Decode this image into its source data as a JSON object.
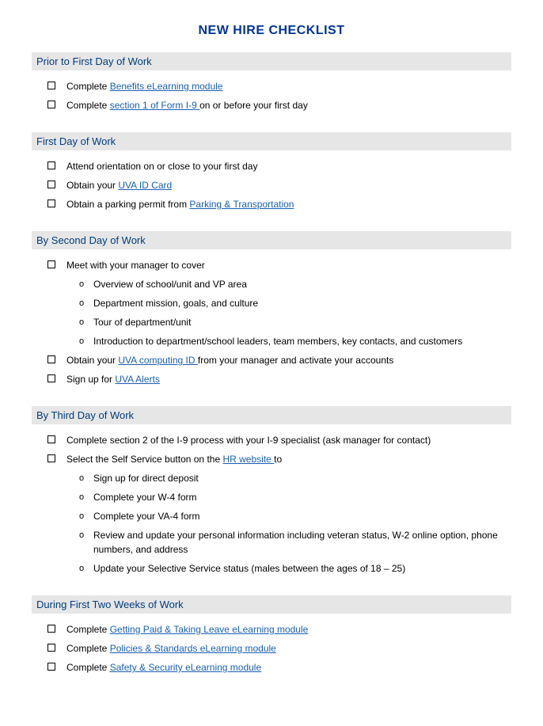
{
  "title": "NEW HIRE CHECKLIST",
  "sections": [
    {
      "header": "Prior to First Day of Work",
      "items": [
        {
          "parts": [
            {
              "text": "Complete "
            },
            {
              "text": "Benefits eLearning module",
              "link": true
            }
          ]
        },
        {
          "parts": [
            {
              "text": "Complete "
            },
            {
              "text": "section 1 of Form I-9 ",
              "link": true
            },
            {
              "text": "on or before your first day"
            }
          ]
        }
      ]
    },
    {
      "header": "First Day of Work",
      "items": [
        {
          "parts": [
            {
              "text": "Attend orientation on or close to your first day"
            }
          ]
        },
        {
          "parts": [
            {
              "text": "Obtain your "
            },
            {
              "text": "UVA ID Card",
              "link": true
            }
          ]
        },
        {
          "parts": [
            {
              "text": "Obtain a parking permit from "
            },
            {
              "text": "Parking & Transportation",
              "link": true
            }
          ]
        }
      ]
    },
    {
      "header": "By Second Day of Work",
      "items": [
        {
          "parts": [
            {
              "text": "Meet with your manager to cover"
            }
          ],
          "subitems": [
            {
              "text": "Overview of school/unit and VP area"
            },
            {
              "text": "Department mission, goals, and culture"
            },
            {
              "text": "Tour of department/unit"
            },
            {
              "text": "Introduction to department/school leaders, team members, key contacts, and customers"
            }
          ]
        },
        {
          "parts": [
            {
              "text": "Obtain your "
            },
            {
              "text": "UVA computing ID ",
              "link": true
            },
            {
              "text": "from your manager and activate your accounts"
            }
          ]
        },
        {
          "parts": [
            {
              "text": "Sign up for "
            },
            {
              "text": "UVA Alerts",
              "link": true
            }
          ]
        }
      ]
    },
    {
      "header": "By Third Day of Work",
      "items": [
        {
          "parts": [
            {
              "text": "Complete section 2 of the I-9 process with your I-9 specialist (ask manager for contact)"
            }
          ]
        },
        {
          "parts": [
            {
              "text": "Select the Self Service button on the "
            },
            {
              "text": "HR website ",
              "link": true
            },
            {
              "text": "to"
            }
          ],
          "subitems": [
            {
              "text": "Sign up for direct deposit"
            },
            {
              "text": "Complete your W-4 form"
            },
            {
              "text": "Complete your VA-4 form"
            },
            {
              "text": "Review and update your personal information including veteran status, W-2 online option, phone numbers, and address"
            },
            {
              "text": "Update your Selective Service status (males between the ages of 18 – 25)"
            }
          ]
        }
      ]
    },
    {
      "header": "During First Two Weeks of Work",
      "items": [
        {
          "parts": [
            {
              "text": "Complete "
            },
            {
              "text": "Getting Paid & Taking Leave eLearning module",
              "link": true
            }
          ]
        },
        {
          "parts": [
            {
              "text": "Complete "
            },
            {
              "text": "Policies & Standards eLearning module",
              "link": true
            }
          ]
        },
        {
          "parts": [
            {
              "text": "Complete "
            },
            {
              "text": "Safety & Security eLearning module",
              "link": true
            }
          ]
        }
      ]
    }
  ]
}
